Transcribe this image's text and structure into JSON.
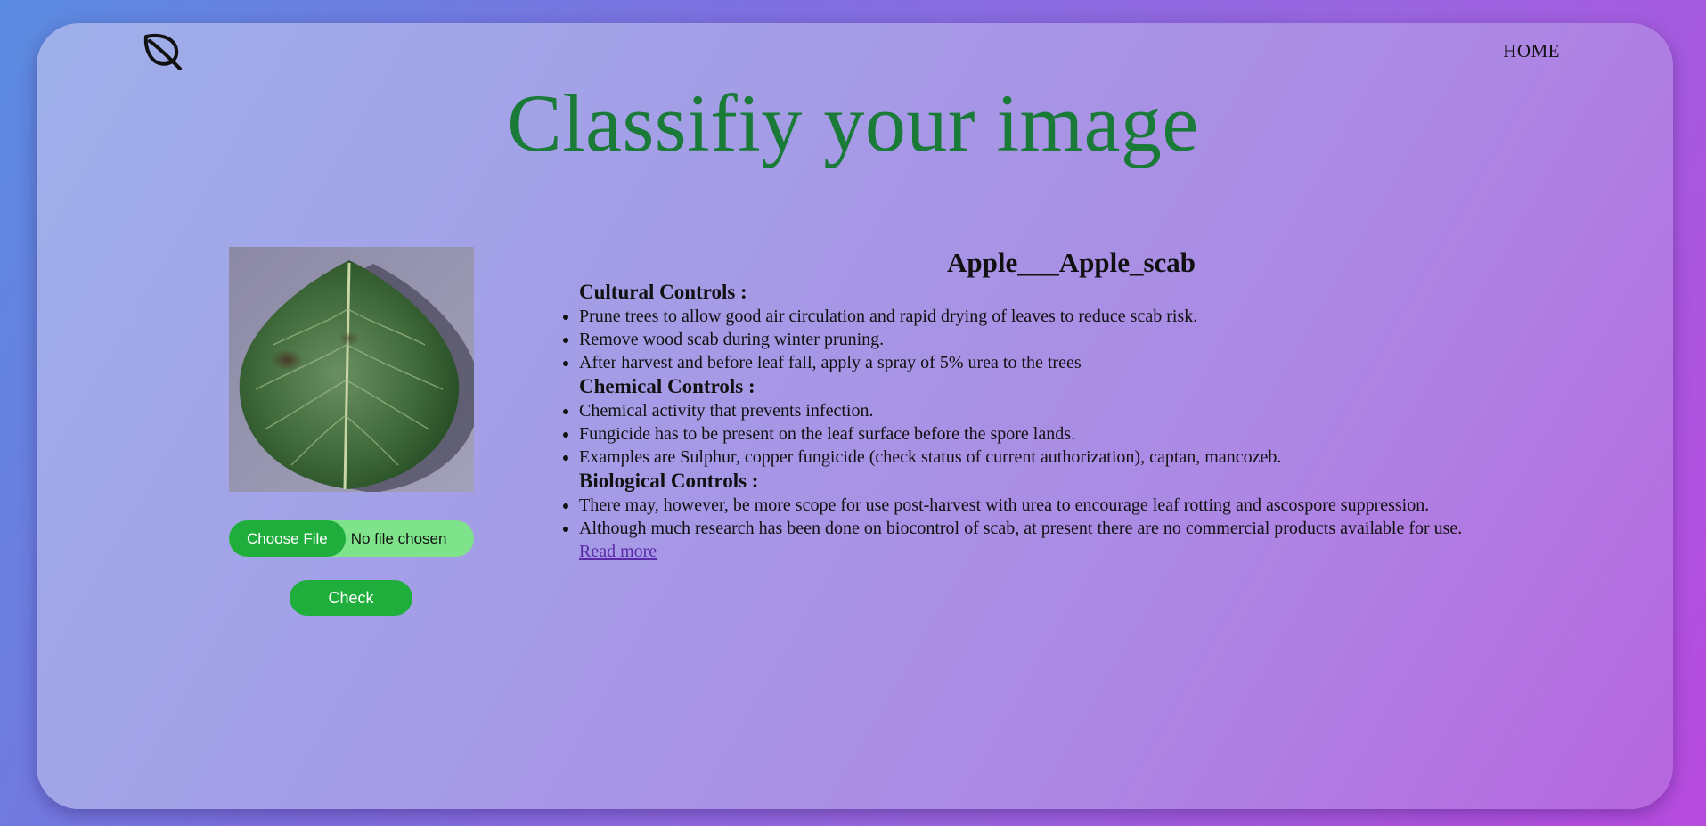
{
  "nav": {
    "logo_icon": "leaf-icon",
    "home_label": "HOME"
  },
  "page": {
    "title": "Classifiy your image"
  },
  "upload": {
    "image_alt": "leaf",
    "choose_file_label": "Choose File",
    "file_status": "No file chosen",
    "check_label": "Check"
  },
  "result": {
    "disease_name": "Apple___Apple_scab",
    "sections": [
      {
        "heading": "Cultural Controls :",
        "items": [
          "Prune trees to allow good air circulation and rapid drying of leaves to reduce scab risk.",
          "Remove wood scab during winter pruning.",
          "After harvest and before leaf fall, apply a spray of 5% urea to the trees"
        ]
      },
      {
        "heading": "Chemical Controls :",
        "items": [
          "Chemical activity that prevents infection.",
          "Fungicide has to be present on the leaf surface before the spore lands.",
          "Examples are Sulphur, copper fungicide (check status of current authorization), captan, mancozeb."
        ]
      },
      {
        "heading": "Biological Controls :",
        "items": [
          "There may, however, be more scope for use post-harvest with urea to encourage leaf rotting and ascospore suppression.",
          "Although much research has been done on biocontrol of scab, at present there are no commercial products available for use."
        ]
      }
    ],
    "read_more_label": "Read more"
  },
  "colors": {
    "title_green": "#1a7a37",
    "button_green": "#1fae3c",
    "file_field_green": "#7ee38a",
    "link_purple": "#5b2aa8"
  }
}
